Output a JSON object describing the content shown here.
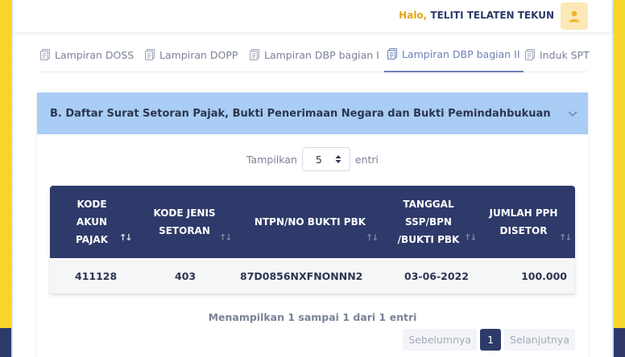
{
  "header": {
    "greeting": "Halo,",
    "user_name": "TELITI TELATEN TEKUN",
    "avatar_icon": "user-icon"
  },
  "tabs": [
    {
      "label": "Lampiran DOSS",
      "icon": "document-icon",
      "active": false
    },
    {
      "label": "Lampiran DOPP",
      "icon": "document-icon",
      "active": false
    },
    {
      "label": "Lampiran DBP bagian I",
      "icon": "document-icon",
      "active": false
    },
    {
      "label": "Lampiran DBP bagian II",
      "icon": "document-icon",
      "active": true
    },
    {
      "label": "Induk SPT",
      "icon": "document-icon",
      "active": false
    }
  ],
  "section": {
    "title": "B. Daftar Surat Setoran Pajak, Bukti Penerimaan Negara dan Bukti Pemindahbukuan",
    "toggle_icon": "chevron-down-icon"
  },
  "length_control": {
    "prefix": "Tampilkan",
    "value": "5",
    "suffix": "entri"
  },
  "table": {
    "columns": [
      "KODE AKUN PAJAK",
      "KODE JENIS SETORAN",
      "NTPN/NO BUKTI PBK",
      "TANGGAL SSP/BPN /BUKTI PBK",
      "JUMLAH PPH DISETOR"
    ],
    "column_lines": [
      [
        "KODE",
        "AKUN",
        "PAJAK"
      ],
      [
        "KODE JENIS",
        "SETORAN"
      ],
      [
        "NTPN/NO BUKTI PBK"
      ],
      [
        "TANGGAL",
        "SSP/BPN",
        "/BUKTI PBK"
      ],
      [
        "JUMLAH PPH",
        "DISETOR"
      ]
    ],
    "rows": [
      [
        "411128",
        "403",
        "87D0856NXFNONNN2",
        "03-06-2022",
        "100.000"
      ]
    ]
  },
  "info_text": "Menampilkan 1 sampai 1 dari 1 entri",
  "pagination": {
    "prev_label": "Sebelumnya",
    "current_page": "1",
    "next_label": "Selanjutnya"
  },
  "colors": {
    "navy": "#2e3a69",
    "section_header": "#a9cdf5",
    "accent_yellow": "#f3c71b",
    "greeting_orange": "#e8a317"
  }
}
